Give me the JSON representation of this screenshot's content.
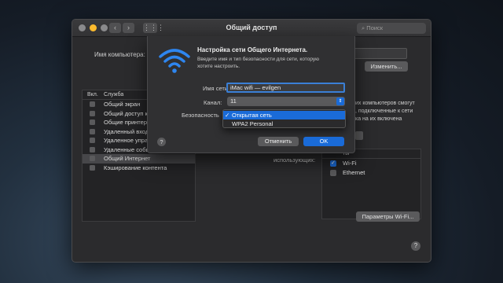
{
  "window": {
    "title": "Общий доступ",
    "search_placeholder": "Поиск",
    "nav_back": "‹",
    "nav_forward": "›",
    "grid_icon": "⋮⋮⋮"
  },
  "computer": {
    "label": "Имя компьютера:",
    "change_button": "Изменить..."
  },
  "services": {
    "header_on": "Вкл.",
    "header_service": "Служба",
    "items": [
      {
        "label": "Общий экран",
        "selected": false
      },
      {
        "label": "Общий доступ к",
        "selected": false
      },
      {
        "label": "Общие принтеры",
        "selected": false
      },
      {
        "label": "Удаленный вход",
        "selected": false
      },
      {
        "label": "Удаленное упра",
        "selected": false
      },
      {
        "label": "Удаленные собы",
        "selected": false
      },
      {
        "label": "Общий Интернет",
        "selected": true
      },
      {
        "label": "Кэширование контента",
        "selected": false
      }
    ]
  },
  "side_text": {
    "line1": "их компьютеров смогут",
    "line2": ", подключенные к сети",
    "line3": "ка на их включена"
  },
  "interfaces": {
    "using_label": "использующих:",
    "header": "ты",
    "items": [
      {
        "label": "Wi-Fi",
        "checked": true
      },
      {
        "label": "Ethernet",
        "checked": false
      }
    ],
    "wifi_params_button": "Параметры Wi-Fi..."
  },
  "help": "?",
  "sheet": {
    "title": "Настройка сети Общего Интернета.",
    "description": "Введите имя и тип безопасности для сети, которую хотите настроить.",
    "net_name_label": "Имя сети:",
    "net_name_value": "iMac wifi — evilgen",
    "channel_label": "Канал:",
    "channel_value": "11",
    "security_label": "Безопасность",
    "security_options": [
      {
        "label": "Открытая сеть",
        "checked": true
      },
      {
        "label": "WPA2 Personal",
        "checked": false
      }
    ],
    "checkmark": "✓",
    "select_arrows": "⇕",
    "cancel_button": "Отменить",
    "ok_button": "OK"
  },
  "colors": {
    "accent": "#1a6bd8",
    "wifi_icon": "#2e86f0"
  }
}
